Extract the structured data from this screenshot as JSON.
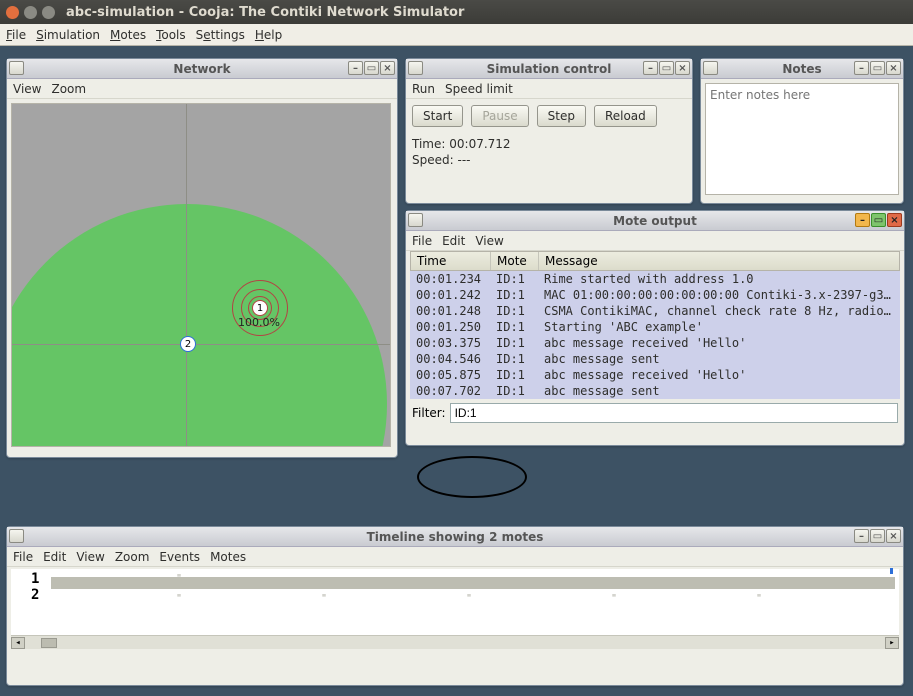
{
  "window": {
    "title": "abc-simulation - Cooja: The Contiki Network Simulator"
  },
  "menubar": {
    "file": "File",
    "simulation": "Simulation",
    "motes": "Motes",
    "tools": "Tools",
    "settings": "Settings",
    "help": "Help"
  },
  "network": {
    "title": "Network",
    "menu": {
      "view": "View",
      "zoom": "Zoom"
    },
    "motes": {
      "m1": "1",
      "m2": "2",
      "percent": "100.0%"
    }
  },
  "simcontrol": {
    "title": "Simulation control",
    "menu": {
      "run": "Run",
      "speed": "Speed limit"
    },
    "buttons": {
      "start": "Start",
      "pause": "Pause",
      "step": "Step",
      "reload": "Reload"
    },
    "time_label": "Time:",
    "time_value": "00:07.712",
    "speed_label": "Speed:",
    "speed_value": "---"
  },
  "notes": {
    "title": "Notes",
    "placeholder": "Enter notes here"
  },
  "moteoutput": {
    "title": "Mote output",
    "menu": {
      "file": "File",
      "edit": "Edit",
      "view": "View"
    },
    "cols": {
      "time": "Time",
      "mote": "Mote",
      "message": "Message"
    },
    "rows": [
      {
        "time": "00:01.234",
        "mote": "ID:1",
        "msg": "Rime started with address 1.0"
      },
      {
        "time": "00:01.242",
        "mote": "ID:1",
        "msg": "MAC 01:00:00:00:00:00:00:00 Contiki-3.x-2397-g36..."
      },
      {
        "time": "00:01.248",
        "mote": "ID:1",
        "msg": "CSMA ContikiMAC, channel check rate 8 Hz, radio ..."
      },
      {
        "time": "00:01.250",
        "mote": "ID:1",
        "msg": "Starting 'ABC example'"
      },
      {
        "time": "00:03.375",
        "mote": "ID:1",
        "msg": "abc message received 'Hello'"
      },
      {
        "time": "00:04.546",
        "mote": "ID:1",
        "msg": "abc message sent"
      },
      {
        "time": "00:05.875",
        "mote": "ID:1",
        "msg": "abc message received 'Hello'"
      },
      {
        "time": "00:07.702",
        "mote": "ID:1",
        "msg": "abc message sent"
      }
    ],
    "filter_label": "Filter:",
    "filter_value": "ID:1"
  },
  "timeline": {
    "title": "Timeline showing 2 motes",
    "menu": {
      "file": "File",
      "edit": "Edit",
      "view": "View",
      "zoom": "Zoom",
      "events": "Events",
      "motes": "Motes"
    },
    "rows": {
      "r1": "1",
      "r2": "2"
    }
  }
}
